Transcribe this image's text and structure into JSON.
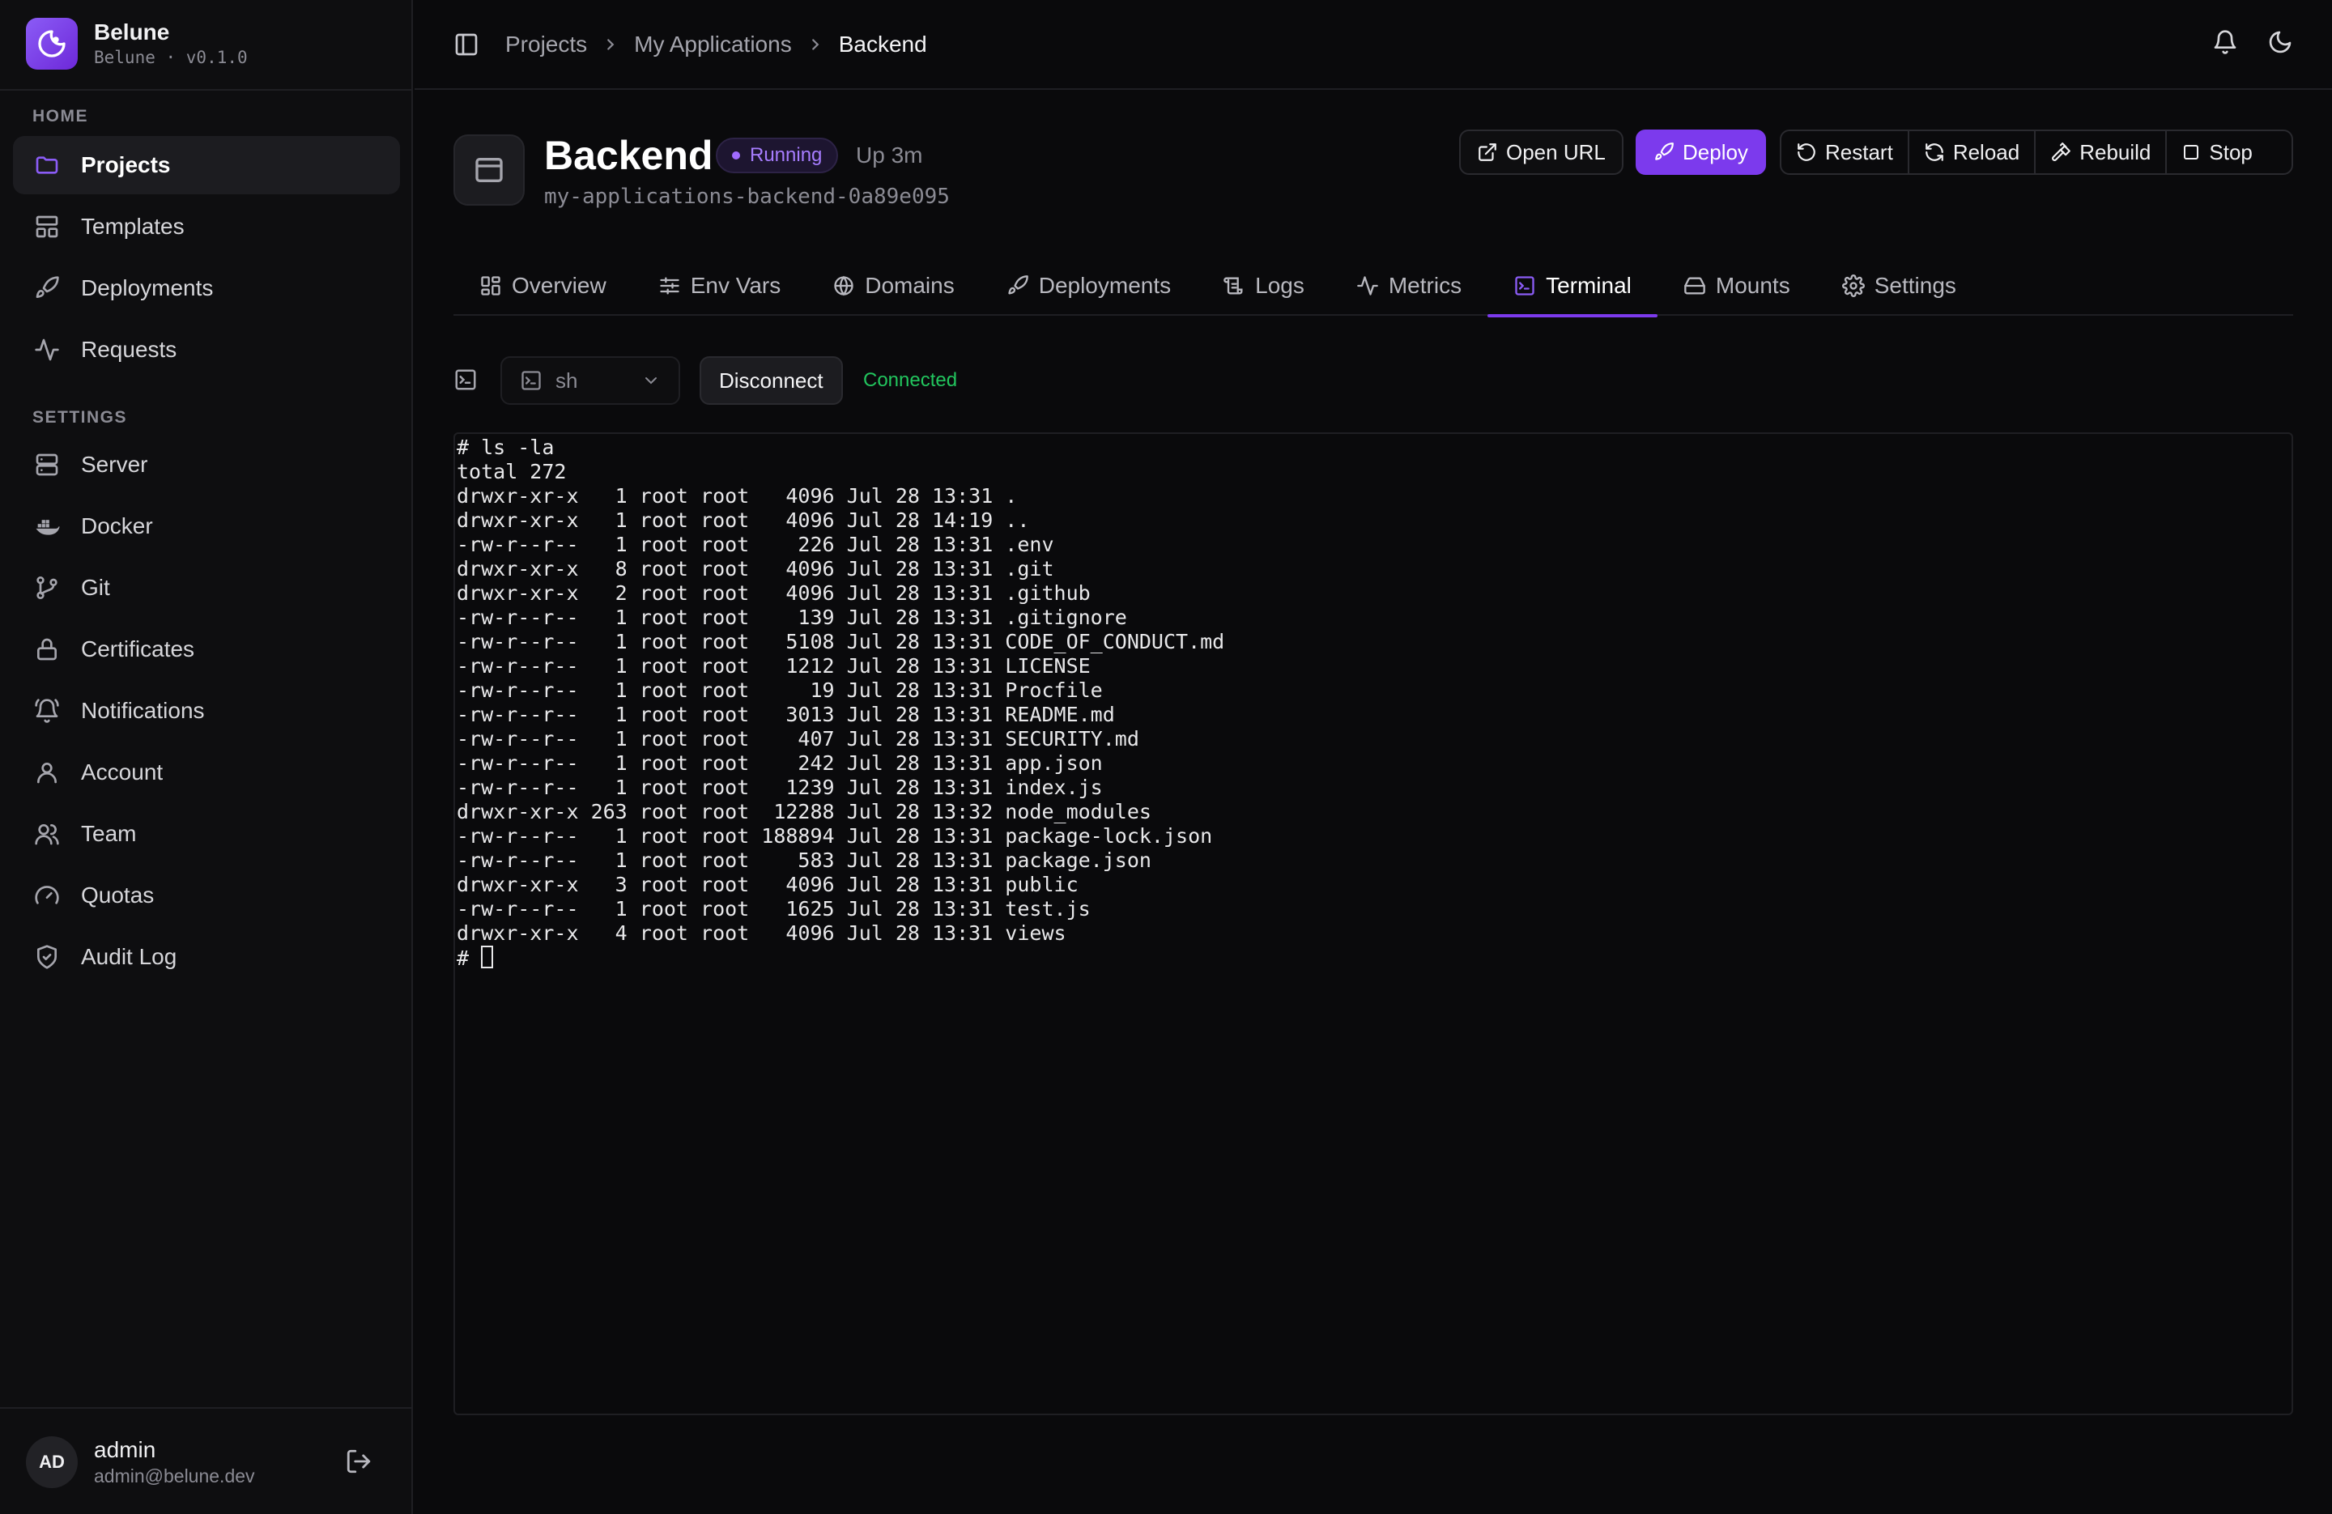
{
  "brand": {
    "name": "Belune",
    "subtitle": "Belune · v0.1.0"
  },
  "sidebar": {
    "home_label": "HOME",
    "home_items": [
      {
        "label": "Projects",
        "icon": "folder-icon",
        "active": true
      },
      {
        "label": "Templates",
        "icon": "layout-icon"
      },
      {
        "label": "Deployments",
        "icon": "rocket-icon"
      },
      {
        "label": "Requests",
        "icon": "activity-icon"
      }
    ],
    "settings_label": "SETTINGS",
    "settings_items": [
      {
        "label": "Server",
        "icon": "server-icon"
      },
      {
        "label": "Docker",
        "icon": "docker-icon"
      },
      {
        "label": "Git",
        "icon": "git-branch-icon"
      },
      {
        "label": "Certificates",
        "icon": "lock-icon"
      },
      {
        "label": "Notifications",
        "icon": "bell-ring-icon"
      },
      {
        "label": "Account",
        "icon": "user-icon"
      },
      {
        "label": "Team",
        "icon": "users-icon"
      },
      {
        "label": "Quotas",
        "icon": "gauge-icon"
      },
      {
        "label": "Audit Log",
        "icon": "shield-check-icon"
      }
    ]
  },
  "user": {
    "initials": "AD",
    "name": "admin",
    "email": "admin@belune.dev"
  },
  "breadcrumb": [
    "Projects",
    "My Applications",
    "Backend"
  ],
  "app": {
    "title": "Backend",
    "status": "Running",
    "uptime": "Up 3m",
    "slug": "my-applications-backend-0a89e095"
  },
  "actions": {
    "open_url": "Open URL",
    "deploy": "Deploy",
    "restart": "Restart",
    "reload": "Reload",
    "rebuild": "Rebuild",
    "stop": "Stop"
  },
  "tabs": [
    {
      "label": "Overview",
      "icon": "grid-icon"
    },
    {
      "label": "Env Vars",
      "icon": "sliders-icon"
    },
    {
      "label": "Domains",
      "icon": "globe-icon"
    },
    {
      "label": "Deployments",
      "icon": "rocket-icon"
    },
    {
      "label": "Logs",
      "icon": "scroll-icon"
    },
    {
      "label": "Metrics",
      "icon": "activity-icon"
    },
    {
      "label": "Terminal",
      "icon": "terminal-icon",
      "active": true
    },
    {
      "label": "Mounts",
      "icon": "hard-drive-icon"
    },
    {
      "label": "Settings",
      "icon": "gear-icon"
    }
  ],
  "terminal": {
    "shell": "sh",
    "disconnect_label": "Disconnect",
    "status": "Connected",
    "lines": [
      "# ls -la",
      "total 272",
      "drwxr-xr-x   1 root root   4096 Jul 28 13:31 .",
      "drwxr-xr-x   1 root root   4096 Jul 28 14:19 ..",
      "-rw-r--r--   1 root root    226 Jul 28 13:31 .env",
      "drwxr-xr-x   8 root root   4096 Jul 28 13:31 .git",
      "drwxr-xr-x   2 root root   4096 Jul 28 13:31 .github",
      "-rw-r--r--   1 root root    139 Jul 28 13:31 .gitignore",
      "-rw-r--r--   1 root root   5108 Jul 28 13:31 CODE_OF_CONDUCT.md",
      "-rw-r--r--   1 root root   1212 Jul 28 13:31 LICENSE",
      "-rw-r--r--   1 root root     19 Jul 28 13:31 Procfile",
      "-rw-r--r--   1 root root   3013 Jul 28 13:31 README.md",
      "-rw-r--r--   1 root root    407 Jul 28 13:31 SECURITY.md",
      "-rw-r--r--   1 root root    242 Jul 28 13:31 app.json",
      "-rw-r--r--   1 root root   1239 Jul 28 13:31 index.js",
      "drwxr-xr-x 263 root root  12288 Jul 28 13:32 node_modules",
      "-rw-r--r--   1 root root 188894 Jul 28 13:31 package-lock.json",
      "-rw-r--r--   1 root root    583 Jul 28 13:31 package.json",
      "drwxr-xr-x   3 root root   4096 Jul 28 13:31 public",
      "-rw-r--r--   1 root root   1625 Jul 28 13:31 test.js",
      "drwxr-xr-x   4 root root   4096 Jul 28 13:31 views"
    ],
    "prompt": "# "
  },
  "colors": {
    "accent": "#7c3aed",
    "connected": "#22c55e",
    "background": "#0a0a0c"
  }
}
